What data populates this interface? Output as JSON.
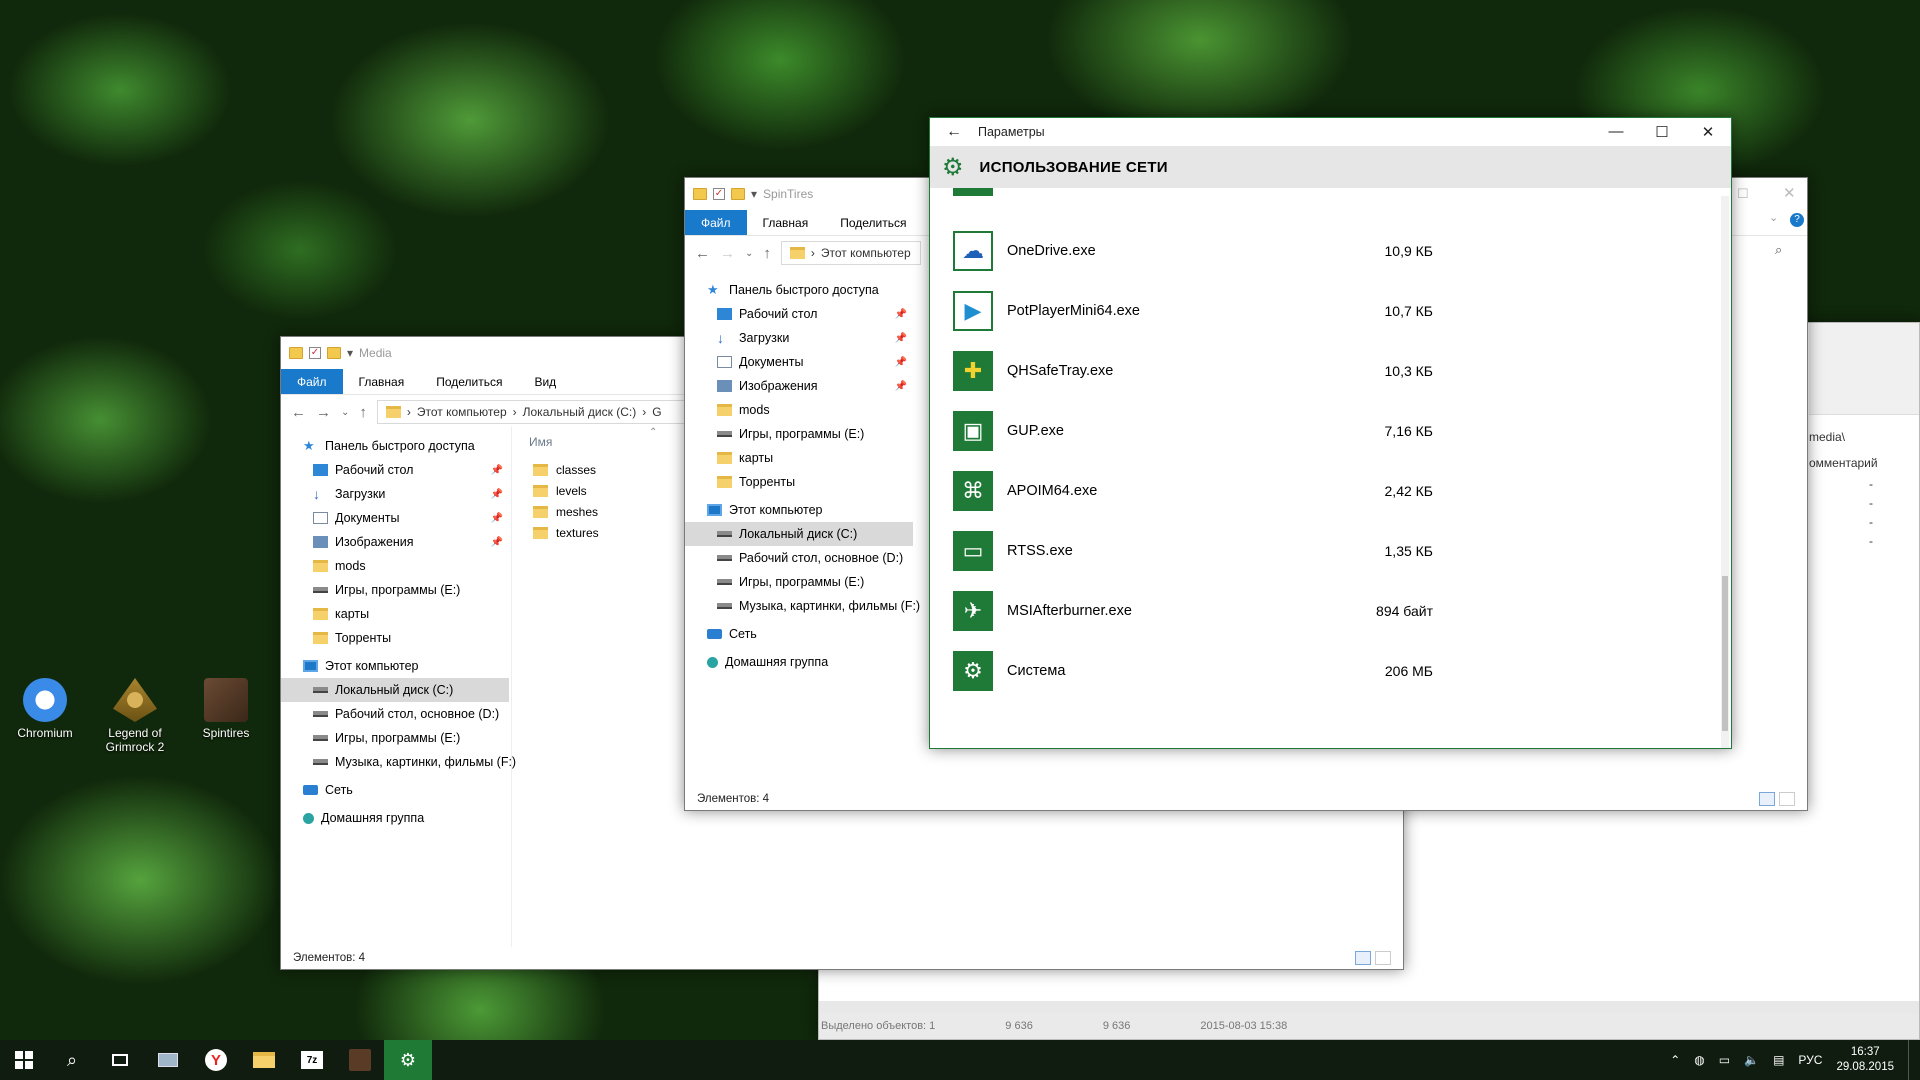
{
  "desktop": {
    "icons": [
      {
        "label": "Chromium"
      },
      {
        "label": "Legend of Grimrock 2"
      },
      {
        "label": "Spintires"
      }
    ]
  },
  "media_window": {
    "title": "Media",
    "ribbon": [
      "Файл",
      "Главная",
      "Поделиться",
      "Вид"
    ],
    "address": [
      "Этот компьютер",
      "Локальный диск (C:)",
      "G"
    ],
    "column_name": "Имя",
    "nav": [
      {
        "label": "Панель быстрого доступа",
        "icon": "star"
      },
      {
        "label": "Рабочий стол",
        "icon": "desk",
        "pinned": true
      },
      {
        "label": "Загрузки",
        "icon": "dl",
        "pinned": true
      },
      {
        "label": "Документы",
        "icon": "doc",
        "pinned": true
      },
      {
        "label": "Изображения",
        "icon": "img",
        "pinned": true
      },
      {
        "label": "mods",
        "icon": "folder"
      },
      {
        "label": "Игры, программы (E:)",
        "icon": "drive"
      },
      {
        "label": "карты",
        "icon": "folder"
      },
      {
        "label": "Торренты",
        "icon": "folder"
      },
      {
        "label": "Этот компьютер",
        "icon": "pc"
      },
      {
        "label": "Локальный диск (C:)",
        "icon": "drive",
        "selected": true
      },
      {
        "label": "Рабочий стол, основное (D:)",
        "icon": "drive"
      },
      {
        "label": "Игры, программы (E:)",
        "icon": "drive"
      },
      {
        "label": "Музыка, картинки, фильмы (F:)",
        "icon": "drive"
      },
      {
        "label": "Сеть",
        "icon": "net"
      },
      {
        "label": "Домашняя группа",
        "icon": "home"
      }
    ],
    "files": [
      "classes",
      "levels",
      "meshes",
      "textures"
    ],
    "status": "Элементов: 4"
  },
  "spintires_window": {
    "title": "SpinTires",
    "ribbon": [
      "Файл",
      "Главная",
      "Поделиться",
      "Ви"
    ],
    "address": "Этот компьютер",
    "status": "Элементов: 4"
  },
  "back_window": {
    "path_fragment": "media\\",
    "column": "омментарий",
    "dashes": [
      "-",
      "-",
      "-",
      "-"
    ],
    "statusbar": [
      "Выделено объектов: 1",
      "9 636",
      "9 636",
      "2015-08-03 15:38"
    ]
  },
  "settings": {
    "window_title": "Параметры",
    "header": "ИСПОЛЬЗОВАНИЕ СЕТИ",
    "apps": [
      {
        "name": "OneDrive.exe",
        "size": "10,9 КБ",
        "icon": "cloud-icon"
      },
      {
        "name": "PotPlayerMini64.exe",
        "size": "10,7 КБ",
        "icon": "play-icon"
      },
      {
        "name": "QHSafeTray.exe",
        "size": "10,3 КБ",
        "icon": "plus-shield-icon"
      },
      {
        "name": "GUP.exe",
        "size": "7,16 КБ",
        "icon": "window-icon"
      },
      {
        "name": "APOIM64.exe",
        "size": "2,42 КБ",
        "icon": "network-icon"
      },
      {
        "name": "RTSS.exe",
        "size": "1,35 КБ",
        "icon": "monitor-icon"
      },
      {
        "name": "MSIAfterburner.exe",
        "size": "894 байт",
        "icon": "afterburner-icon"
      },
      {
        "name": "Система",
        "size": "206 МБ",
        "icon": "gear-icon"
      }
    ]
  },
  "taskbar": {
    "lang": "РУС",
    "time": "16:37",
    "date": "29.08.2015"
  },
  "colors": {
    "accent": "#1e7a36",
    "file_tab": "#1979ca"
  }
}
